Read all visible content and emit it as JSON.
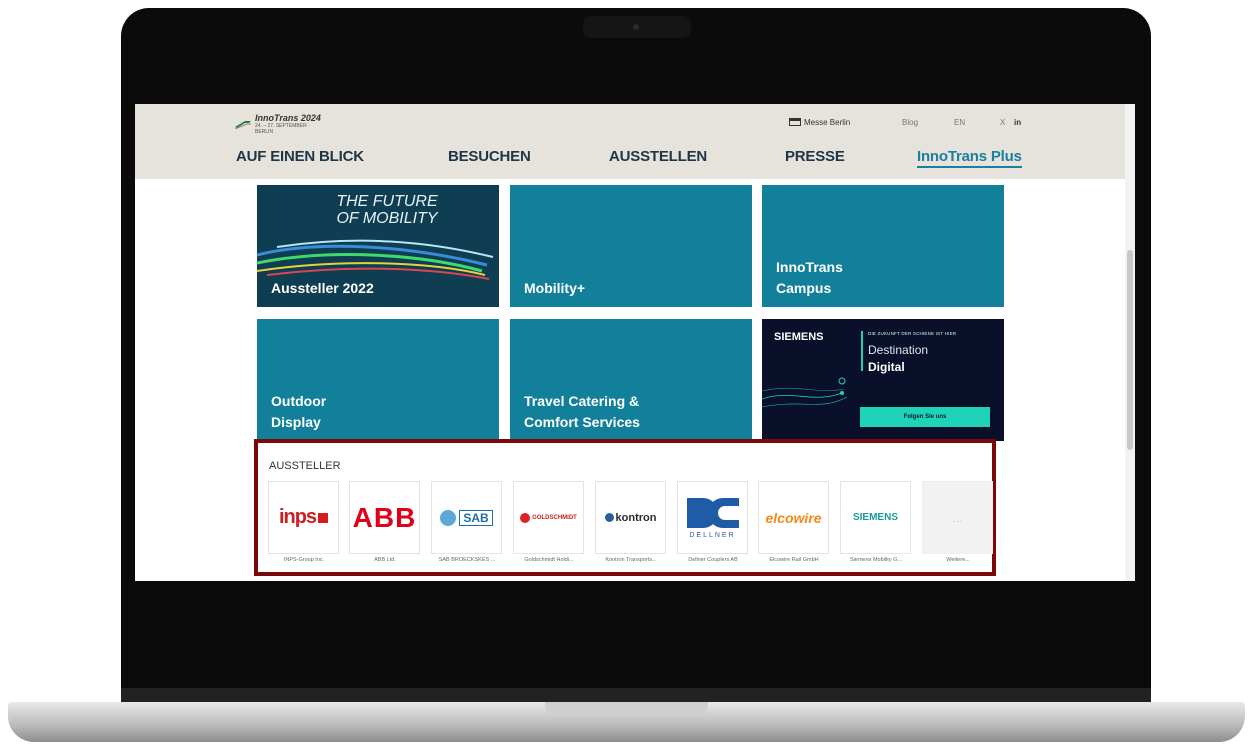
{
  "header": {
    "logo_title": "InnoTrans 2024",
    "logo_date": "24. – 27. SEPTEMBER · BERLIN",
    "messe": "Messe Berlin",
    "blog": "Blog",
    "lang": "EN",
    "social_x": "X",
    "social_in": "in"
  },
  "nav": {
    "items": [
      "AUF EINEN BLICK",
      "BESUCHEN",
      "AUSSTELLEN",
      "PRESSE",
      "InnoTrans Plus"
    ]
  },
  "tiles": {
    "future": "THE FUTURE\nOF MOBILITY",
    "aussteller": "Aussteller 2022",
    "mobility": "Mobility+",
    "campus": "InnoTrans\nCampus",
    "outdoor": "Outdoor\nDisplay",
    "catering": "Travel Catering &\nComfort Services"
  },
  "ad": {
    "brand": "SIEMENS",
    "small": "DIE ZUKUNFT DER SCHIENE IST HIER",
    "dest": "Destination",
    "digital": "Digital",
    "button": "Folgen Sie uns"
  },
  "exhibitors": {
    "title": "AUSSTELLER",
    "items": [
      {
        "logo": "inps",
        "name": "INPS-Group Inc."
      },
      {
        "logo": "ABB",
        "name": "ABB Ltd."
      },
      {
        "logo": "SAB",
        "name": "SAB BROECKSKES ..."
      },
      {
        "logo": "GOLDSCHMIDT",
        "name": "Goldschmidt Holdi..."
      },
      {
        "logo": "kontron",
        "name": "Kontron Transports..."
      },
      {
        "logo": "DELLNER",
        "name": "Dellner Couplers AB"
      },
      {
        "logo": "elcowire",
        "name": "Elcowire Rail GmbH"
      },
      {
        "logo": "SIEMENS",
        "name": "Siemens Mobility G..."
      },
      {
        "logo": "...",
        "name": "Weitere..."
      }
    ]
  },
  "colors": {
    "tile": "#12809b",
    "nav_text": "#1e3645",
    "highlight_border": "#7a0a0a",
    "header_bg": "#e6e3dc"
  }
}
